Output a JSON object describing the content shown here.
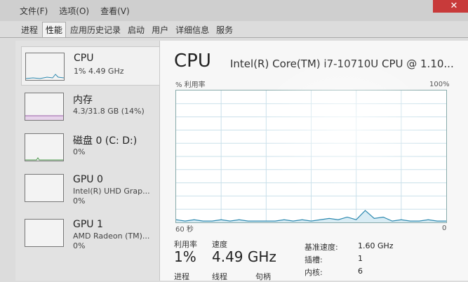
{
  "menu": {
    "items": [
      "文件(F)",
      "选项(O)",
      "查看(V)"
    ]
  },
  "tabs": [
    {
      "label": "进程"
    },
    {
      "label": "性能"
    },
    {
      "label": "应用历史记录"
    },
    {
      "label": "启动"
    },
    {
      "label": "用户"
    },
    {
      "label": "详细信息"
    },
    {
      "label": "服务"
    }
  ],
  "active_tab": "性能",
  "sidebar": {
    "items": [
      {
        "title": "CPU",
        "sub": "1% 4.49 GHz"
      },
      {
        "title": "内存",
        "sub": "4.3/31.8 GB (14%)"
      },
      {
        "title": "磁盘 0 (C: D:)",
        "sub": "0%"
      },
      {
        "title": "GPU 0",
        "sub": "Intel(R) UHD Grap...",
        "sub2": "0%"
      },
      {
        "title": "GPU 1",
        "sub": "AMD Radeon (TM)...",
        "sub2": "0%"
      }
    ]
  },
  "main": {
    "title": "CPU",
    "model": "Intel(R) Core(TM) i7-10710U CPU @ 1.10...",
    "graph": {
      "ylabel": "% 利用率",
      "ymax_label": "100%",
      "xlabel": "60 秒",
      "xmin_label": "0",
      "colors": {
        "line": "#2f8ab0",
        "grid": "#c9e0ea"
      }
    },
    "stats": {
      "util_label": "利用率",
      "util_value": "1%",
      "speed_label": "速度",
      "speed_value": "4.49 GHz",
      "processes_label": "进程",
      "threads_label": "线程",
      "handles_label": "句柄"
    },
    "info": [
      {
        "label": "基准速度:",
        "value": "1.60 GHz"
      },
      {
        "label": "插槽:",
        "value": "1"
      },
      {
        "label": "内核:",
        "value": "6"
      }
    ]
  },
  "chart_data": {
    "type": "line",
    "x": [
      0,
      2,
      4,
      6,
      8,
      10,
      12,
      14,
      16,
      18,
      20,
      22,
      24,
      26,
      28,
      30,
      32,
      34,
      36,
      38,
      40,
      42,
      44,
      46,
      48,
      50,
      52,
      54,
      56,
      58,
      60
    ],
    "series": [
      {
        "values": [
          2,
          1,
          2,
          1,
          1,
          2,
          1,
          2,
          1,
          1,
          1,
          1,
          2,
          1,
          2,
          1,
          2,
          3,
          2,
          4,
          2,
          9,
          3,
          4,
          1,
          2,
          1,
          1,
          2,
          1,
          1
        ]
      }
    ],
    "ylim": [
      0,
      100
    ],
    "xlabel": "60 秒",
    "ylabel": "% 利用率"
  }
}
